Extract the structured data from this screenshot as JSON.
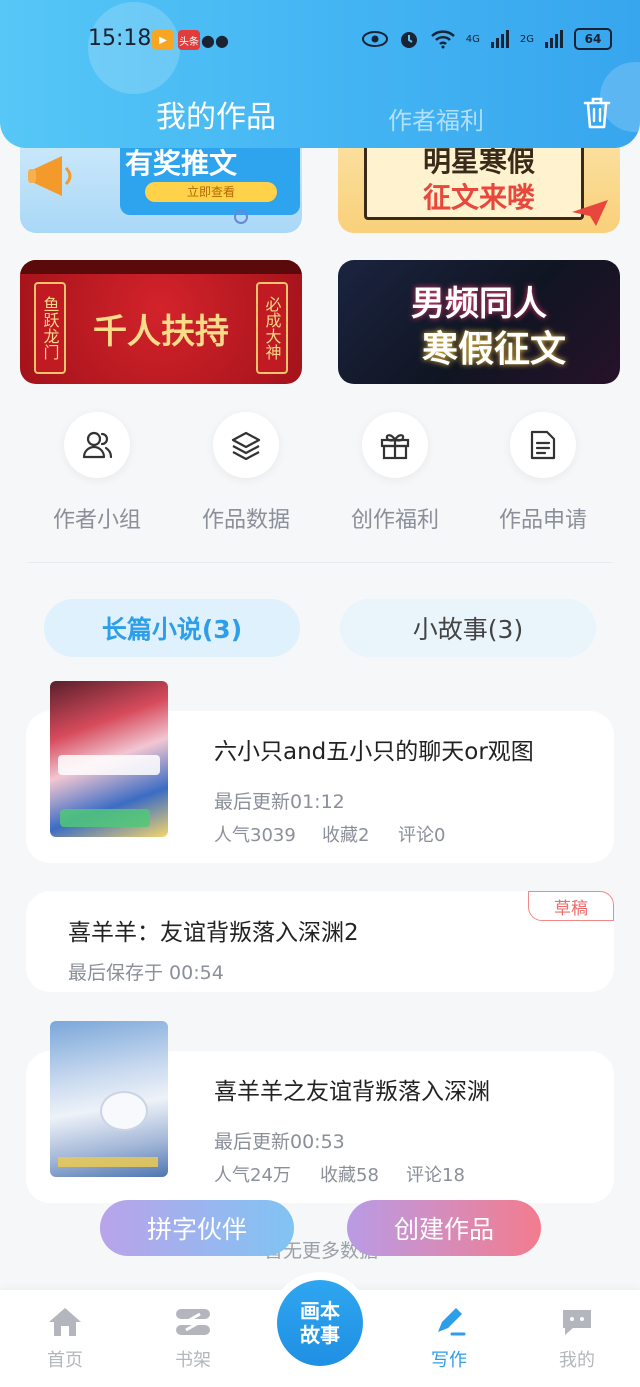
{
  "status_bar": {
    "time": "15:18",
    "apps": [
      "video-app-icon",
      "toutiao-app-icon",
      "wechat-icon"
    ],
    "toutiao_label": "头条",
    "network_4g": "4G",
    "network_2g": "2G",
    "battery": "64"
  },
  "header": {
    "tab_active": "我的作品",
    "tab_inactive": "作者福利",
    "action_icon": "trash-icon"
  },
  "banners": [
    {
      "name": "有奖推文",
      "button": "立即查看"
    },
    {
      "name_line1": "明星寒假",
      "name_line2": "征文来喽"
    },
    {
      "name": "千人扶持",
      "left_scroll": "鱼跃龙门",
      "right_scroll": "必成大神"
    },
    {
      "name_line1": "男频同人",
      "name_line2": "寒假征文"
    }
  ],
  "quick_actions": [
    {
      "label": "作者小组",
      "icon": "group-icon"
    },
    {
      "label": "作品数据",
      "icon": "layers-icon"
    },
    {
      "label": "创作福利",
      "icon": "gift-icon"
    },
    {
      "label": "作品申请",
      "icon": "document-icon"
    }
  ],
  "segments": {
    "active": "长篇小说(3)",
    "inactive": "小故事(3)"
  },
  "works": [
    {
      "title": "六小只and五小只的聊天or观图",
      "updated": "最后更新01:12",
      "popularity": "人气3039",
      "favorites": "收藏2",
      "comments": "评论0"
    },
    {
      "title": "喜羊羊：友谊背叛落入深渊2",
      "saved": "最后保存于 00:54",
      "badge": "草稿"
    },
    {
      "title": "喜羊羊之友谊背叛落入深渊",
      "updated": "最后更新00:53",
      "popularity": "人气24万",
      "favorites": "收藏58",
      "comments": "评论18"
    }
  ],
  "floating_buttons": {
    "left": "拼字伙伴",
    "right": "创建作品"
  },
  "list_end": "暂无更多数据",
  "bottom_nav": {
    "home": "首页",
    "shelf": "书架",
    "center_line1": "画本",
    "center_line2": "故事",
    "write": "写作",
    "mine": "我的"
  },
  "colors": {
    "accent": "#2f9ee8",
    "header_gradient_start": "#56c7f6",
    "draft_badge": "#ef6c6c"
  }
}
